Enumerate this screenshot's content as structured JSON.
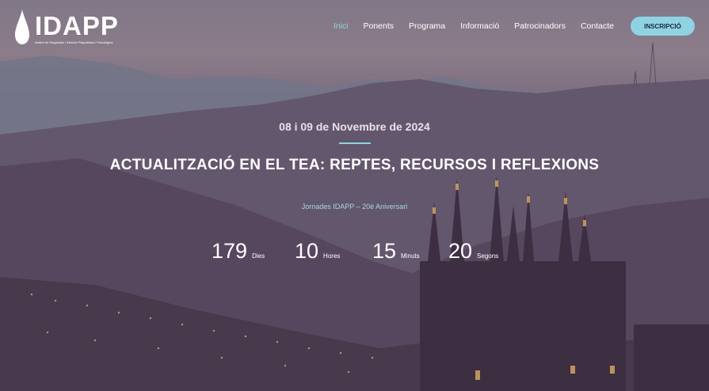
{
  "logo": {
    "name": "IDAPP",
    "tagline": "Institut de Diagnòstic i Atenció Psiquiàtrica i Psicològica"
  },
  "nav": {
    "items": [
      "Inici",
      "Ponents",
      "Programa",
      "Informació",
      "Patrocinadors",
      "Contacte"
    ],
    "active": "Inici",
    "cta": "INSCRIPCIÓ"
  },
  "hero": {
    "date": "08 i 09 de Novembre de 2024",
    "title": "ACTUALITZACIÓ EN EL TEA: REPTES, RECURSOS I REFLEXIONS",
    "subtitle": "Jornades IDAPP – 20è Aniversari"
  },
  "countdown": [
    {
      "value": "179",
      "unit": "Dies"
    },
    {
      "value": "10",
      "unit": "Hores"
    },
    {
      "value": "15",
      "unit": "Minuts"
    },
    {
      "value": "20",
      "unit": "Segons"
    }
  ],
  "colors": {
    "accent": "#8fd3e3",
    "text": "#ffffff"
  }
}
